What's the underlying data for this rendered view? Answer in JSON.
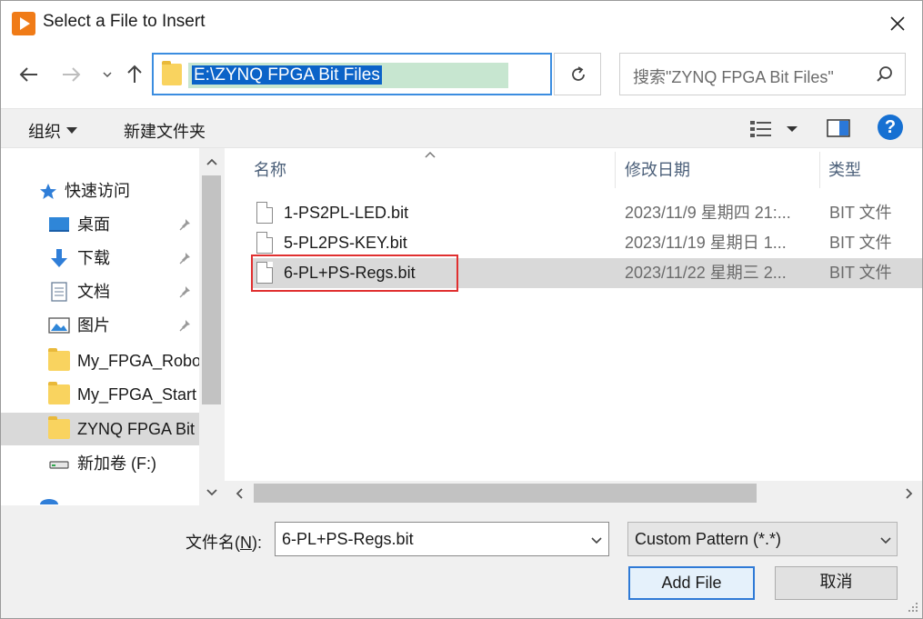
{
  "window": {
    "title": "Select a File to Insert",
    "icon": "vivado-play-icon",
    "accent": "#f07b17"
  },
  "address": {
    "path": "E:\\ZYNQ FPGA Bit Files",
    "selection_color": "#0b63c8"
  },
  "search": {
    "placeholder": "搜索\"ZYNQ FPGA Bit Files\""
  },
  "toolbar": {
    "organize_label": "组织",
    "new_folder_label": "新建文件夹"
  },
  "nav": {
    "quick_access": "快速访问",
    "items": [
      {
        "label": "桌面",
        "icon": "desktop-icon",
        "pinned": true
      },
      {
        "label": "下载",
        "icon": "download-icon",
        "pinned": true
      },
      {
        "label": "文档",
        "icon": "document-icon",
        "pinned": true
      },
      {
        "label": "图片",
        "icon": "pictures-icon",
        "pinned": true
      },
      {
        "label": "My_FPGA_Robo",
        "icon": "folder-icon",
        "pinned": false
      },
      {
        "label": "My_FPGA_Start",
        "icon": "folder-icon",
        "pinned": false
      },
      {
        "label": "ZYNQ FPGA Bit",
        "icon": "folder-icon",
        "pinned": false,
        "selected": true
      },
      {
        "label": "新加卷 (F:)",
        "icon": "drive-icon",
        "pinned": false
      }
    ]
  },
  "columns": {
    "name": "名称",
    "date": "修改日期",
    "type": "类型"
  },
  "files": [
    {
      "name": "1-PS2PL-LED.bit",
      "date": "2023/11/9 星期四 21:...",
      "type": "BIT 文件",
      "selected": false
    },
    {
      "name": "5-PL2PS-KEY.bit",
      "date": "2023/11/19 星期日 1...",
      "type": "BIT 文件",
      "selected": false
    },
    {
      "name": "6-PL+PS-Regs.bit",
      "date": "2023/11/22 星期三 2...",
      "type": "BIT 文件",
      "selected": true
    }
  ],
  "bottom": {
    "filename_label_pre": "文件名(",
    "filename_label_key": "N",
    "filename_label_post": "):",
    "filename_value": "6-PL+PS-Regs.bit",
    "filter_value": "Custom Pattern (*.*)",
    "add_label": "Add File",
    "cancel_label": "取消"
  }
}
